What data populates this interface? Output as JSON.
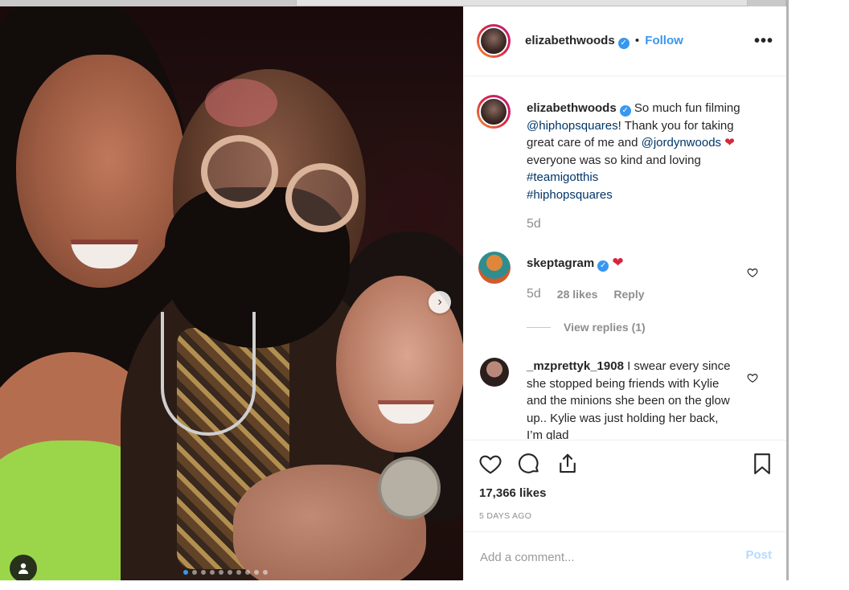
{
  "post": {
    "username": "elizabethwoods",
    "follow_label": "Follow",
    "dot_separator": "•",
    "more_label": "•••",
    "verified_glyph": "✓"
  },
  "caption": {
    "username": "elizabethwoods",
    "text_1": "So much fun filming ",
    "mention_1": "@hiphopsquares",
    "text_2": "! Thank you for taking great care of me and ",
    "mention_2": "@jordynwoods",
    "emoji": "❤",
    "text_3": " everyone was so kind and loving ",
    "hashtag_1": "#teamigotthis",
    "hashtag_2": "#hiphopsquares",
    "time": "5d"
  },
  "comments": [
    {
      "username": "skeptagram",
      "text": "❤",
      "time": "5d",
      "likes": "28 likes",
      "reply_label": "Reply",
      "view_replies": "View replies (1)"
    },
    {
      "username": "_mzprettyk_1908",
      "text": "I swear every since she stopped being friends with Kylie and the minions she been on the glow up.. Kylie was just holding her back, I’m glad"
    }
  ],
  "likes_count": "17,366 likes",
  "date_ago": "5 DAYS AGO",
  "add_comment": {
    "placeholder": "Add a comment...",
    "post_label": "Post"
  },
  "carousel": {
    "count": 10,
    "active_index": 0,
    "next_glyph": "›"
  },
  "colors": {
    "accent": "#3897f0",
    "link": "#003569",
    "muted": "#8e8e8e"
  },
  "icons": [
    "heart-icon",
    "comment-icon",
    "share-icon",
    "bookmark-icon",
    "user-tag-icon",
    "chevron-right-icon",
    "verified-icon",
    "more-icon"
  ]
}
